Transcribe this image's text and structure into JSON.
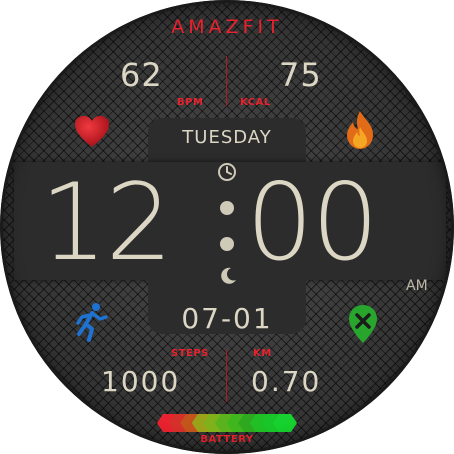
{
  "brand": "AMAZFIT",
  "stats_top": {
    "bpm_value": "62",
    "bpm_label": "BPM",
    "kcal_value": "75",
    "kcal_label": "KCAL"
  },
  "day": "TUESDAY",
  "time": {
    "hours": "12",
    "minutes": "00",
    "ampm": "AM"
  },
  "date": "07-01",
  "stats_bottom": {
    "steps_label": "STEPS",
    "steps_value": "1000",
    "km_label": "KM",
    "km_value": "0.70"
  },
  "battery": {
    "label": "BATTERY",
    "segment_colors": [
      "#e8222e",
      "#d6302a",
      "#c2541c",
      "#9aa21a",
      "#7fb21a",
      "#5ab31c",
      "#3fb51e",
      "#2ea81f",
      "#1fbf25",
      "#19c62a",
      "#16d12e"
    ]
  },
  "icons": {
    "heart": "heart-icon",
    "fire": "flame-icon",
    "run": "running-person-icon",
    "map": "map-pin-icon",
    "clock": "clock-icon",
    "moon": "moon-icon"
  },
  "colors": {
    "accent_red": "#e8222e",
    "text_light": "#dcd6c4",
    "steps_blue": "#1e73d2",
    "map_green": "#27a52c",
    "flame_orange": "#e26b18"
  }
}
